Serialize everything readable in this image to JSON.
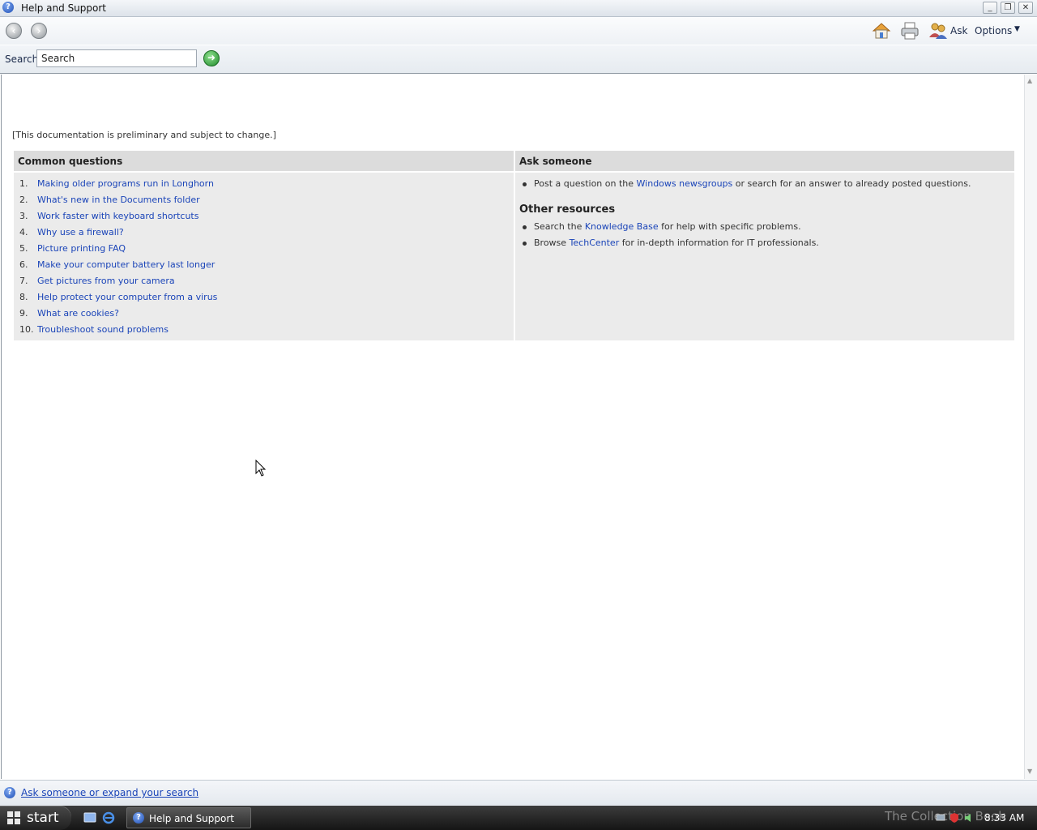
{
  "window": {
    "title": "Help and Support",
    "minimize_glyph": "_",
    "maximize_glyph": "❐",
    "close_glyph": "✕"
  },
  "toolbar": {
    "back_glyph": "‹",
    "forward_glyph": "›",
    "home_icon": "home-icon",
    "print_icon": "printer-icon",
    "ask_icon": "people-icon",
    "ask_label": "Ask",
    "options_label": "Options",
    "options_chevron": "▼"
  },
  "search": {
    "label": "Search",
    "value": "Search",
    "go_glyph": "➜"
  },
  "content": {
    "disclaimer": "[This documentation is preliminary and subject to change.]",
    "common_questions": {
      "heading": "Common questions",
      "items": [
        {
          "num": "1.",
          "text": "Making older programs run in Longhorn"
        },
        {
          "num": "2.",
          "text": "What's new in the Documents folder"
        },
        {
          "num": "3.",
          "text": "Work faster with keyboard shortcuts"
        },
        {
          "num": "4.",
          "text": "Why use a firewall?"
        },
        {
          "num": "5.",
          "text": "Picture printing FAQ"
        },
        {
          "num": "6.",
          "text": "Make your computer battery last longer"
        },
        {
          "num": "7.",
          "text": "Get pictures from your camera"
        },
        {
          "num": "8.",
          "text": "Help protect your computer from a virus"
        },
        {
          "num": "9.",
          "text": "What are cookies?"
        },
        {
          "num": "10.",
          "text": "Troubleshoot sound problems"
        }
      ]
    },
    "ask_someone": {
      "heading": "Ask someone",
      "bullet": {
        "before": "Post a question on the ",
        "link": "Windows newsgroups",
        "after": " or search for an answer to already posted questions."
      }
    },
    "other_resources": {
      "heading": "Other resources",
      "kb": {
        "before": "Search the ",
        "link": "Knowledge Base",
        "after": " for help with specific problems."
      },
      "tc": {
        "before": "Browse ",
        "link": "TechCenter",
        "after": " for in-depth information for IT professionals."
      }
    }
  },
  "footer": {
    "link": "Ask someone or expand your search"
  },
  "taskbar": {
    "start_label": "start",
    "task_label": "Help and Support",
    "watermark": "The Collection Book",
    "clock": "8:33 AM"
  },
  "colors": {
    "link": "#1a44b8",
    "panel_bg": "#ebebeb",
    "panel_head": "#dcdcdc",
    "taskbar": "#1f1f1f"
  }
}
